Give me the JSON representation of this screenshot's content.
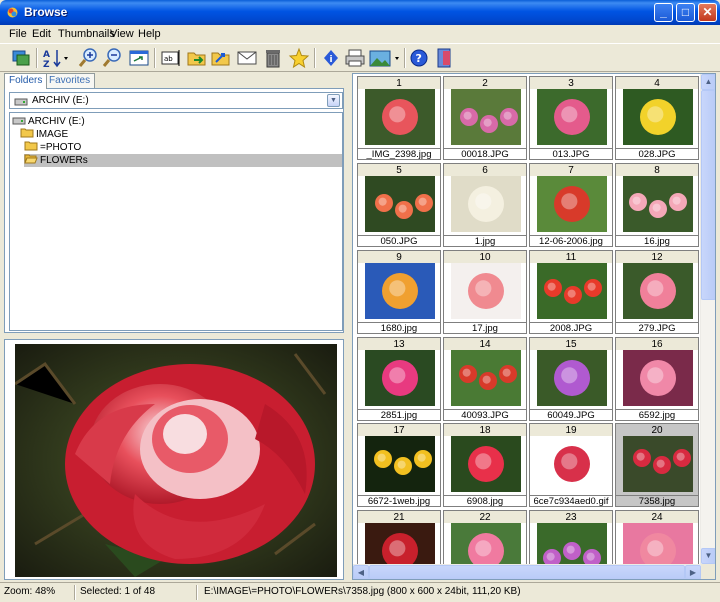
{
  "window": {
    "title": "Browse"
  },
  "menu": [
    "File",
    "Edit",
    "Thumbnails",
    "View",
    "Help"
  ],
  "toolbar": {
    "buttons": [
      "copy-icon",
      "sort-icon",
      "zoom-in-icon",
      "zoom-out-icon",
      "fit-window-icon",
      "rename-icon",
      "move-icon",
      "copy-to-icon",
      "email-icon",
      "delete-icon",
      "favorite-star-icon",
      "info-icon",
      "print-icon",
      "slideshow-icon",
      "help-icon",
      "exit-icon"
    ]
  },
  "left": {
    "tabs": [
      "Folders",
      "Favorites"
    ],
    "drive_combo": "ARCHIV (E:)",
    "tree": [
      {
        "label": "ARCHIV (E:)",
        "icon": "drive-icon",
        "indent": 0
      },
      {
        "label": "IMAGE",
        "icon": "folder-icon",
        "indent": 1
      },
      {
        "label": "=PHOTO",
        "icon": "folder-icon",
        "indent": 2
      },
      {
        "label": "FLOWERs",
        "icon": "folder-open-icon",
        "indent": 3,
        "selected": true
      }
    ]
  },
  "thumbnails": [
    {
      "num": "1",
      "name": "_IMG_2398.jpg",
      "color": "#e8555c",
      "bg": "#3c5a2a"
    },
    {
      "num": "2",
      "name": "00018.JPG",
      "color": "#d86aa8",
      "bg": "#5a7a3a"
    },
    {
      "num": "3",
      "name": "013.JPG",
      "color": "#e45b8c",
      "bg": "#3c6a2c"
    },
    {
      "num": "4",
      "name": "028.JPG",
      "color": "#f2d22a",
      "bg": "#2e5a22"
    },
    {
      "num": "5",
      "name": "050.JPG",
      "color": "#f0704a",
      "bg": "#2f4a22"
    },
    {
      "num": "6",
      "name": "1.jpg",
      "color": "#f4f0e0",
      "bg": "#e0dcc8"
    },
    {
      "num": "7",
      "name": "12-06-2006.jpg",
      "color": "#d83a2a",
      "bg": "#5a8a3a"
    },
    {
      "num": "8",
      "name": "16.jpg",
      "color": "#f4a8b8",
      "bg": "#3a5a2a"
    },
    {
      "num": "9",
      "name": "1680.jpg",
      "color": "#f0a030",
      "bg": "#2a5ab8"
    },
    {
      "num": "10",
      "name": "17.jpg",
      "color": "#f08a90",
      "bg": "#f4f0ee"
    },
    {
      "num": "11",
      "name": "2008.JPG",
      "color": "#e83a2a",
      "bg": "#3a6a28"
    },
    {
      "num": "12",
      "name": "279.JPG",
      "color": "#f0809a",
      "bg": "#3a5a2a"
    },
    {
      "num": "13",
      "name": "2851.jpg",
      "color": "#e83a80",
      "bg": "#2a4a22"
    },
    {
      "num": "14",
      "name": "40093.JPG",
      "color": "#d83a2a",
      "bg": "#4a7a34"
    },
    {
      "num": "15",
      "name": "60049.JPG",
      "color": "#b05ad0",
      "bg": "#3a5a28"
    },
    {
      "num": "16",
      "name": "6592.jpg",
      "color": "#f088a8",
      "bg": "#7a2a4a"
    },
    {
      "num": "17",
      "name": "6672-1web.jpg",
      "color": "#f2c020",
      "bg": "#14240e"
    },
    {
      "num": "18",
      "name": "6908.jpg",
      "color": "#e8304a",
      "bg": "#2a4a1e"
    },
    {
      "num": "19",
      "name": "6ce7c934aed0.gif",
      "color": "#d8304a",
      "bg": "#ffffff"
    },
    {
      "num": "20",
      "name": "7358.jpg",
      "color": "#d82a40",
      "bg": "#3a4a2a",
      "selected": true
    },
    {
      "num": "21",
      "name": "",
      "color": "#c8202c",
      "bg": "#3a1a10"
    },
    {
      "num": "22",
      "name": "",
      "color": "#f07aa0",
      "bg": "#4a7a3a"
    },
    {
      "num": "23",
      "name": "",
      "color": "#c060c8",
      "bg": "#3a6a2a"
    },
    {
      "num": "24",
      "name": "",
      "color": "#f088a0",
      "bg": "#e878a0"
    }
  ],
  "status": {
    "zoom": "Zoom: 48%",
    "selected": "Selected: 1 of 48",
    "path": "E:\\IMAGE\\=PHOTO\\FLOWERs\\7358.jpg (800 x 600 x 24bit, 111,20 KB)"
  }
}
